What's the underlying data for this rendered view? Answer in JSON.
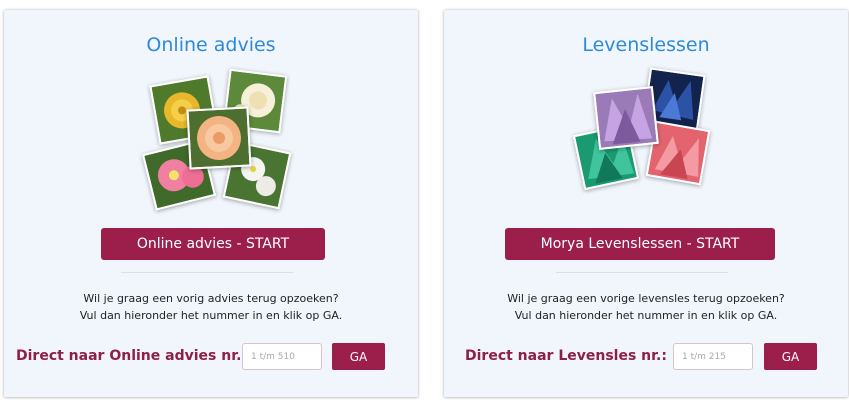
{
  "cards": [
    {
      "title": "Online advies",
      "start_label": "Online advies - START",
      "info_line1": "Wil je graag een vorig advies terug opzoeken?",
      "info_line2": "Vul dan hieronder het nummer in en klik op GA.",
      "direct_label": "Direct naar Online advies nr.:",
      "input_placeholder": "1 t/m 510",
      "input_value": "",
      "go_label": "GA",
      "image": "rose-collage"
    },
    {
      "title": "Levenslessen",
      "start_label": "Morya Levenslessen - START",
      "info_line1": "Wil je graag een vorige levensles terug opzoeken?",
      "info_line2": "Vul dan hieronder het nummer in en klik op GA.",
      "direct_label": "Direct naar Levensles nr.:",
      "input_placeholder": "1 t/m 215",
      "input_value": "",
      "go_label": "GA",
      "image": "crystal-collage"
    }
  ],
  "colors": {
    "title": "#2e8ad8",
    "button": "#9b1e4b",
    "label": "#8f1f45",
    "card_bg": "#f1f6fc"
  }
}
